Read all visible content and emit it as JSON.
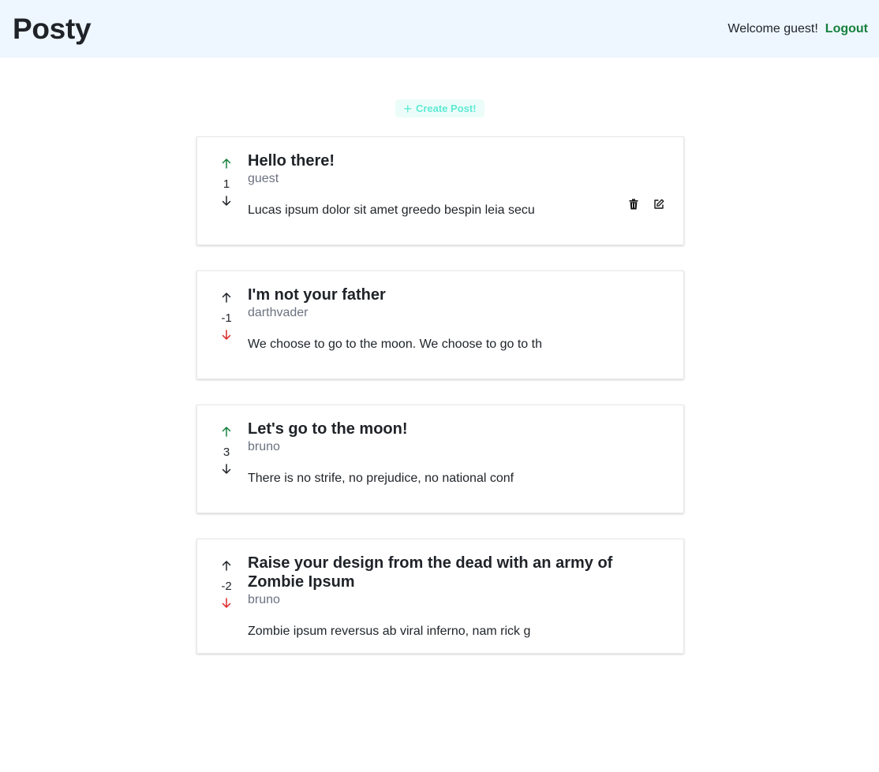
{
  "app": {
    "brand": "Posty",
    "welcome_text": "Welcome guest!",
    "logout_label": "Logout"
  },
  "create_post": {
    "icon": "plus-icon",
    "label": "Create Post!"
  },
  "colors": {
    "header_bg": "#eef6ff",
    "upvoted": "#15803d",
    "downvoted": "#dc2626",
    "neutral_arrow": "#1f2328",
    "create_text": "#5eead4"
  },
  "posts": [
    {
      "title": "Hello there!",
      "author": "guest",
      "score": "1",
      "body": "Lucas ipsum dolor sit amet greedo bespin leia secu",
      "vote_state": "up",
      "actions": [
        "trash-icon",
        "edit-icon"
      ]
    },
    {
      "title": "I'm not your father",
      "author": "darthvader",
      "score": "-1",
      "body": "We choose to go to the moon. We choose to go to th",
      "vote_state": "down"
    },
    {
      "title": "Let's go to the moon!",
      "author": "bruno",
      "score": "3",
      "body": "There is no strife, no prejudice, no national conf",
      "vote_state": "up"
    },
    {
      "title": "Raise your design from the dead with an army of Zombie Ipsum",
      "author": "bruno",
      "score": "-2",
      "body": "Zombie ipsum reversus ab viral inferno, nam rick g",
      "vote_state": "down"
    }
  ]
}
